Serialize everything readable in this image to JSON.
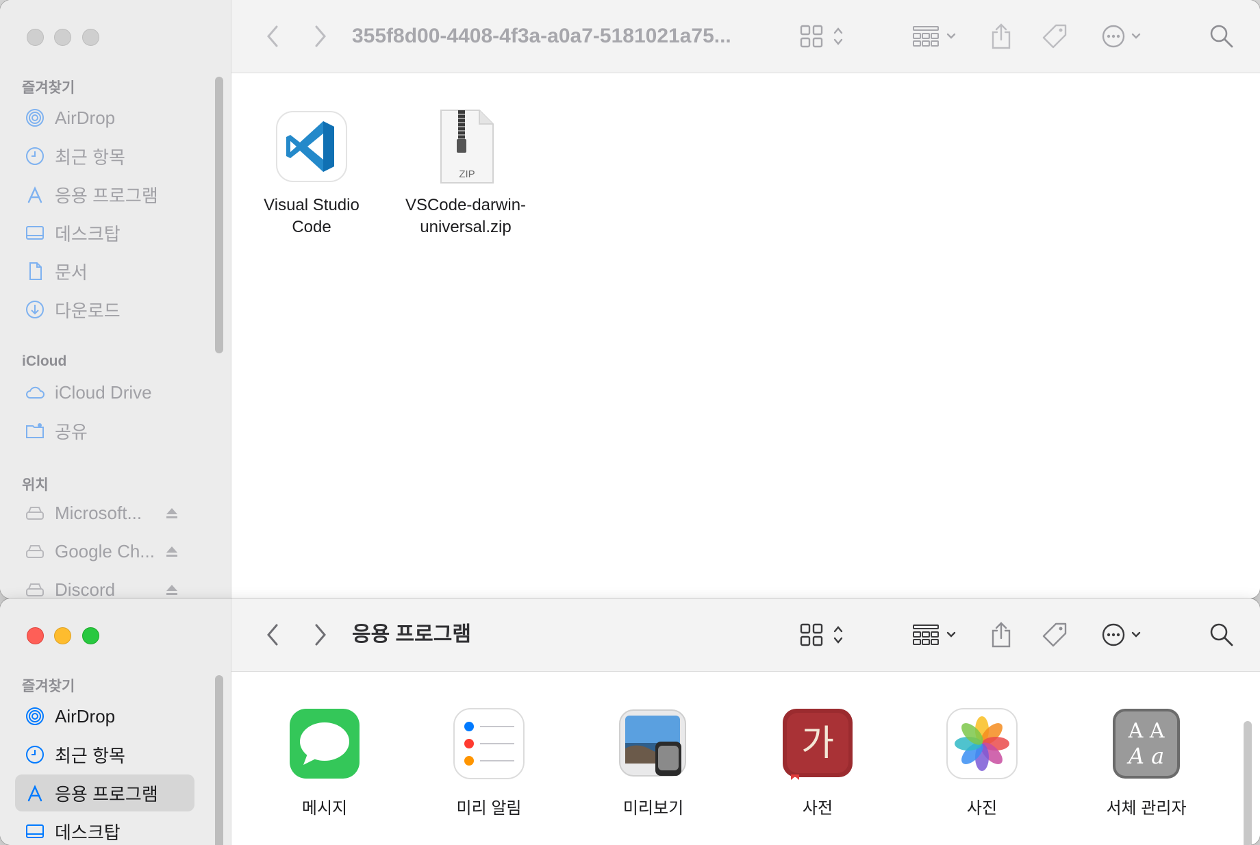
{
  "window1": {
    "title": "355f8d00-4408-4f3a-a0a7-5181021a75...",
    "sidebar": {
      "favorites_label": "즐겨찾기",
      "icloud_label": "iCloud",
      "locations_label": "위치",
      "favorites": [
        {
          "label": "AirDrop",
          "icon": "airdrop-icon"
        },
        {
          "label": "최근 항목",
          "icon": "clock-icon"
        },
        {
          "label": "응용 프로그램",
          "icon": "applications-icon"
        },
        {
          "label": "데스크탑",
          "icon": "desktop-icon"
        },
        {
          "label": "문서",
          "icon": "document-icon"
        },
        {
          "label": "다운로드",
          "icon": "download-icon"
        }
      ],
      "icloud": [
        {
          "label": "iCloud Drive",
          "icon": "cloud-icon"
        },
        {
          "label": "공유",
          "icon": "shared-folder-icon"
        }
      ],
      "locations": [
        {
          "label": "Microsoft...",
          "icon": "drive-icon"
        },
        {
          "label": "Google Ch...",
          "icon": "drive-icon"
        },
        {
          "label": "Discord",
          "icon": "drive-icon"
        }
      ]
    },
    "files": [
      {
        "name_line1": "Visual Studio",
        "name_line2": "Code",
        "icon": "vscode-icon"
      },
      {
        "name_line1": "VSCode-darwin-",
        "name_line2": "universal.zip",
        "icon": "zip-file-icon",
        "badge": "ZIP"
      }
    ]
  },
  "window2": {
    "title": "응용 프로그램",
    "sidebar": {
      "favorites_label": "즐겨찾기",
      "favorites": [
        {
          "label": "AirDrop",
          "icon": "airdrop-icon"
        },
        {
          "label": "최근 항목",
          "icon": "clock-icon"
        },
        {
          "label": "응용 프로그램",
          "icon": "applications-icon",
          "selected": true
        },
        {
          "label": "데스크탑",
          "icon": "desktop-icon"
        }
      ]
    },
    "apps": [
      {
        "name": "메시지",
        "icon": "messages-icon"
      },
      {
        "name": "미리 알림",
        "icon": "reminders-icon"
      },
      {
        "name": "미리보기",
        "icon": "preview-icon"
      },
      {
        "name": "사전",
        "icon": "dictionary-icon",
        "glyph": "가"
      },
      {
        "name": "사진",
        "icon": "photos-icon"
      },
      {
        "name": "서체 관리자",
        "icon": "font-book-icon",
        "glyph_top": "A A",
        "glyph_bottom": "A a"
      }
    ]
  },
  "colors": {
    "accent": "#007aff",
    "sidebar_bg": "#ececec",
    "toolbar_bg": "#f3f3f3"
  }
}
